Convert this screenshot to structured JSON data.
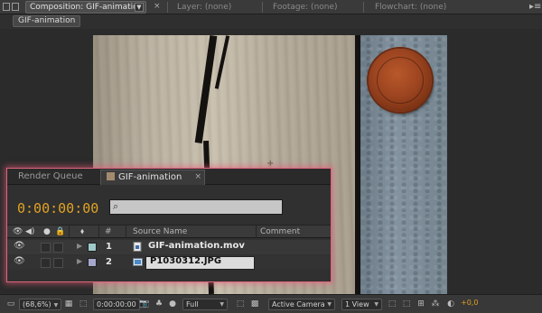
{
  "topbar": {
    "composition_tab": "Composition: GIF-animation",
    "close_symbol": "×",
    "tabs": [
      "Layer: (none)",
      "Footage: (none)",
      "Flowchart: (none)"
    ],
    "menu_symbol": "▸≡"
  },
  "breadcrumb": "GIF-animation",
  "timeline": {
    "tabs": {
      "render_queue": "Render Queue",
      "comp": "GIF-animation",
      "close": "×"
    },
    "timecode": "0:00:00:00",
    "search_placeholder": "",
    "columns": {
      "number": "#",
      "source_name": "Source Name",
      "comment": "Comment"
    },
    "layers": [
      {
        "number": "1",
        "name": "GIF-animation.mov",
        "label_color": "#9fc8c8"
      },
      {
        "number": "2",
        "name": "P1030312.JPG",
        "label_color": "#a6a7cc"
      }
    ]
  },
  "bottombar": {
    "zoom": "(68,6%)",
    "timecode": "0:00:00:00",
    "resolution": "Full",
    "camera": "Active Camera",
    "views": "1 View",
    "exposure": "+0,0"
  },
  "colors": {
    "timecode": "#e2a224",
    "highlight": "#d9647a",
    "coin": "#9c4420"
  }
}
